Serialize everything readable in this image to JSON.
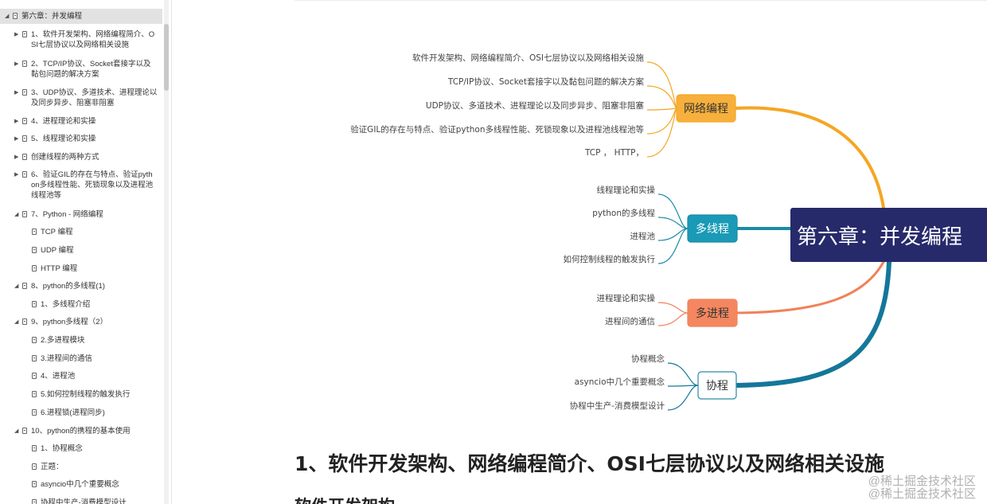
{
  "outline": [
    {
      "label": "第六章：并发编程",
      "level": 0,
      "expanded": true,
      "active": true
    },
    {
      "label": "1、软件开发架构、网络编程简介、OSI七层协议以及网络相关设施",
      "lines": [
        "1、软件开发架构、网络编程简介、O",
        "SI七层协议以及网络相关设施"
      ],
      "level": 1,
      "expanded": false
    },
    {
      "label": "2、TCP/IP协议、Socket套接字以及黏包问题的解决方案",
      "lines": [
        "2、TCP/IP协议、Socket套接字以及",
        "黏包问题的解决方案"
      ],
      "level": 1,
      "expanded": false
    },
    {
      "label": "3、UDP协议、多道技术、进程理论以及同步异步、阻塞非阻塞",
      "lines": [
        "3、UDP协议、多道技术、进程理论以",
        "及同步异步、阻塞非阻塞"
      ],
      "level": 1,
      "expanded": false
    },
    {
      "label": "4、进程理论和实操",
      "level": 1,
      "expanded": false
    },
    {
      "label": "5、线程理论和实操",
      "level": 1,
      "expanded": false
    },
    {
      "label": "创建线程的两种方式",
      "level": 1,
      "expanded": false
    },
    {
      "label": "6、验证GIL的存在与特点、验证python多线程性能、死锁现象以及进程池线程池等",
      "lines": [
        "6、验证GIL的存在与特点、验证pyth",
        "on多线程性能、死锁现象以及进程池",
        "线程池等"
      ],
      "level": 1,
      "expanded": false
    },
    {
      "label": "7、Python - 网络编程",
      "level": 1,
      "expanded": true
    },
    {
      "label": "TCP 编程",
      "level": 2
    },
    {
      "label": "UDP 编程",
      "level": 2
    },
    {
      "label": "HTTP 编程",
      "level": 2
    },
    {
      "label": "8、python的多线程(1)",
      "level": 1,
      "expanded": true
    },
    {
      "label": "1、多线程介绍",
      "level": 2
    },
    {
      "label": "9、python多线程（2）",
      "level": 1,
      "expanded": true
    },
    {
      "label": "2.多进程模块",
      "level": 2
    },
    {
      "label": "3.进程间的通信",
      "level": 2
    },
    {
      "label": "4、进程池",
      "level": 2
    },
    {
      "label": "5.如何控制线程的触发执行",
      "level": 2
    },
    {
      "label": "6.进程锁(进程同步)",
      "level": 2
    },
    {
      "label": "10、python的携程的基本使用",
      "level": 1,
      "expanded": true
    },
    {
      "label": "1、协程概念",
      "level": 2
    },
    {
      "label": "正题：",
      "level": 2
    },
    {
      "label": "asyncio中几个重要概念",
      "level": 2
    },
    {
      "label": "协程中生产-消费模型设计",
      "level": 2
    }
  ],
  "mindmap": {
    "root": "第六章：并发编程",
    "branches": [
      {
        "label": "网络编程",
        "color": "#f5a623",
        "text_color": "#333333",
        "border": "#f5a623",
        "fill": "#f7b03c",
        "leaves": [
          "软件开发架构、网络编程简介、OSI七层协议以及网络相关设施",
          "TCP/IP协议、Socket套接字以及黏包问题的解决方案",
          "UDP协议、多道技术、进程理论以及同步异步、阻塞非阻塞",
          "验证GIL的存在与特点、验证python多线程性能、死锁现象以及进程池线程池等",
          "TCP ，  HTTP，"
        ]
      },
      {
        "label": "多线程",
        "color": "#1a8ba5",
        "text_color": "#ffffff",
        "border": "#1a8ba5",
        "fill": "#1a9ab6",
        "leaves": [
          "线程理论和实操",
          "python的多线程",
          "进程池",
          "如何控制线程的触发执行"
        ]
      },
      {
        "label": "多进程",
        "color": "#f0825a",
        "text_color": "#333333",
        "border": "#f0825a",
        "fill": "#f4875f",
        "leaves": [
          "进程理论和实操",
          "进程间的通信"
        ]
      },
      {
        "label": "协程",
        "color": "#14779a",
        "text_color": "#333333",
        "border": "#2a8aa8",
        "fill": "#ffffff",
        "leaves": [
          "协程概念",
          "asyncio中几个重要概念",
          "协程中生产-消费模型设计"
        ]
      }
    ],
    "root_fill": "#262a6b"
  },
  "content": {
    "heading": "1、软件开发架构、网络编程简介、OSI七层协议以及网络相关设施",
    "subheading": "软件开发架构"
  },
  "watermark": {
    "line1": "@稀土掘金技术社区",
    "line2": "@稀土掘金技术社区"
  }
}
